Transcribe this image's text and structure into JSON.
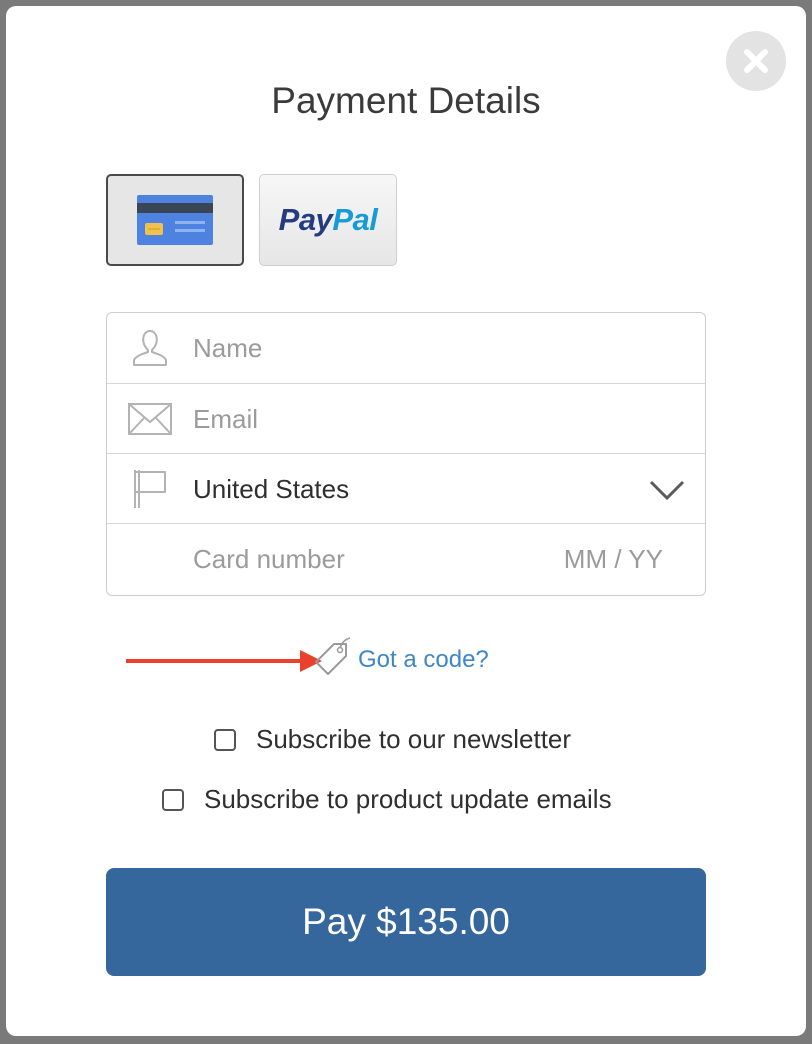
{
  "dialog": {
    "title": "Payment Details",
    "close_icon": "close-icon"
  },
  "payment_methods": {
    "card_icon": "credit-card-icon",
    "paypal": {
      "part1": "Pay",
      "part2": "Pal"
    },
    "selected": "card"
  },
  "form": {
    "name": {
      "placeholder": "Name",
      "value": "",
      "icon": "user-icon"
    },
    "email": {
      "placeholder": "Email",
      "value": "",
      "icon": "envelope-icon"
    },
    "country": {
      "value": "United States",
      "icon": "flag-icon",
      "dropdown_icon": "chevron-down-icon"
    },
    "card_number": {
      "placeholder": "Card number",
      "value": ""
    },
    "expiry": {
      "placeholder": "MM / YY",
      "value": ""
    }
  },
  "coupon": {
    "link_label": "Got a code?",
    "icon": "tag-icon",
    "annotation": "red-arrow-pointer"
  },
  "options": [
    {
      "label": "Subscribe to our newsletter",
      "checked": false
    },
    {
      "label": "Subscribe to product update emails",
      "checked": false
    }
  ],
  "pay_button": {
    "label": "Pay $135.00"
  },
  "colors": {
    "accent": "#35679c",
    "link": "#3f86c7",
    "annotation_arrow": "#e8412c"
  }
}
